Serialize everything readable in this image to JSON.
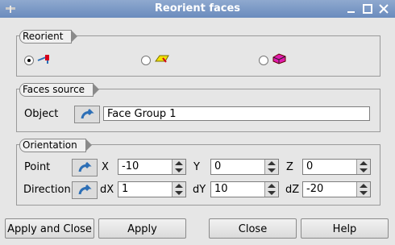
{
  "window": {
    "title": "Reorient faces"
  },
  "reorient": {
    "group_label": "Reorient",
    "options": [
      "point-vector-mode",
      "face-mode",
      "volume-mode"
    ],
    "selected": 0
  },
  "faces_source": {
    "group_label": "Faces source",
    "object_label": "Object",
    "object_value": "Face Group 1"
  },
  "orientation": {
    "group_label": "Orientation",
    "point": {
      "label": "Point",
      "x_label": "X",
      "x": "-10",
      "y_label": "Y",
      "y": "0",
      "z_label": "Z",
      "z": "0"
    },
    "direction": {
      "label": "Direction",
      "dx_label": "dX",
      "dx": "1",
      "dy_label": "dY",
      "dy": "10",
      "dz_label": "dZ",
      "dz": "-20"
    }
  },
  "buttons": {
    "apply_close": "Apply and Close",
    "apply": "Apply",
    "close": "Close",
    "help": "Help"
  },
  "colors": {
    "titlebar": "#7896c6",
    "accent": "#2d6fb6",
    "mode_red": "#d6001c",
    "mode_yellow": "#f2e200",
    "mode_magenta": "#e01cae"
  }
}
